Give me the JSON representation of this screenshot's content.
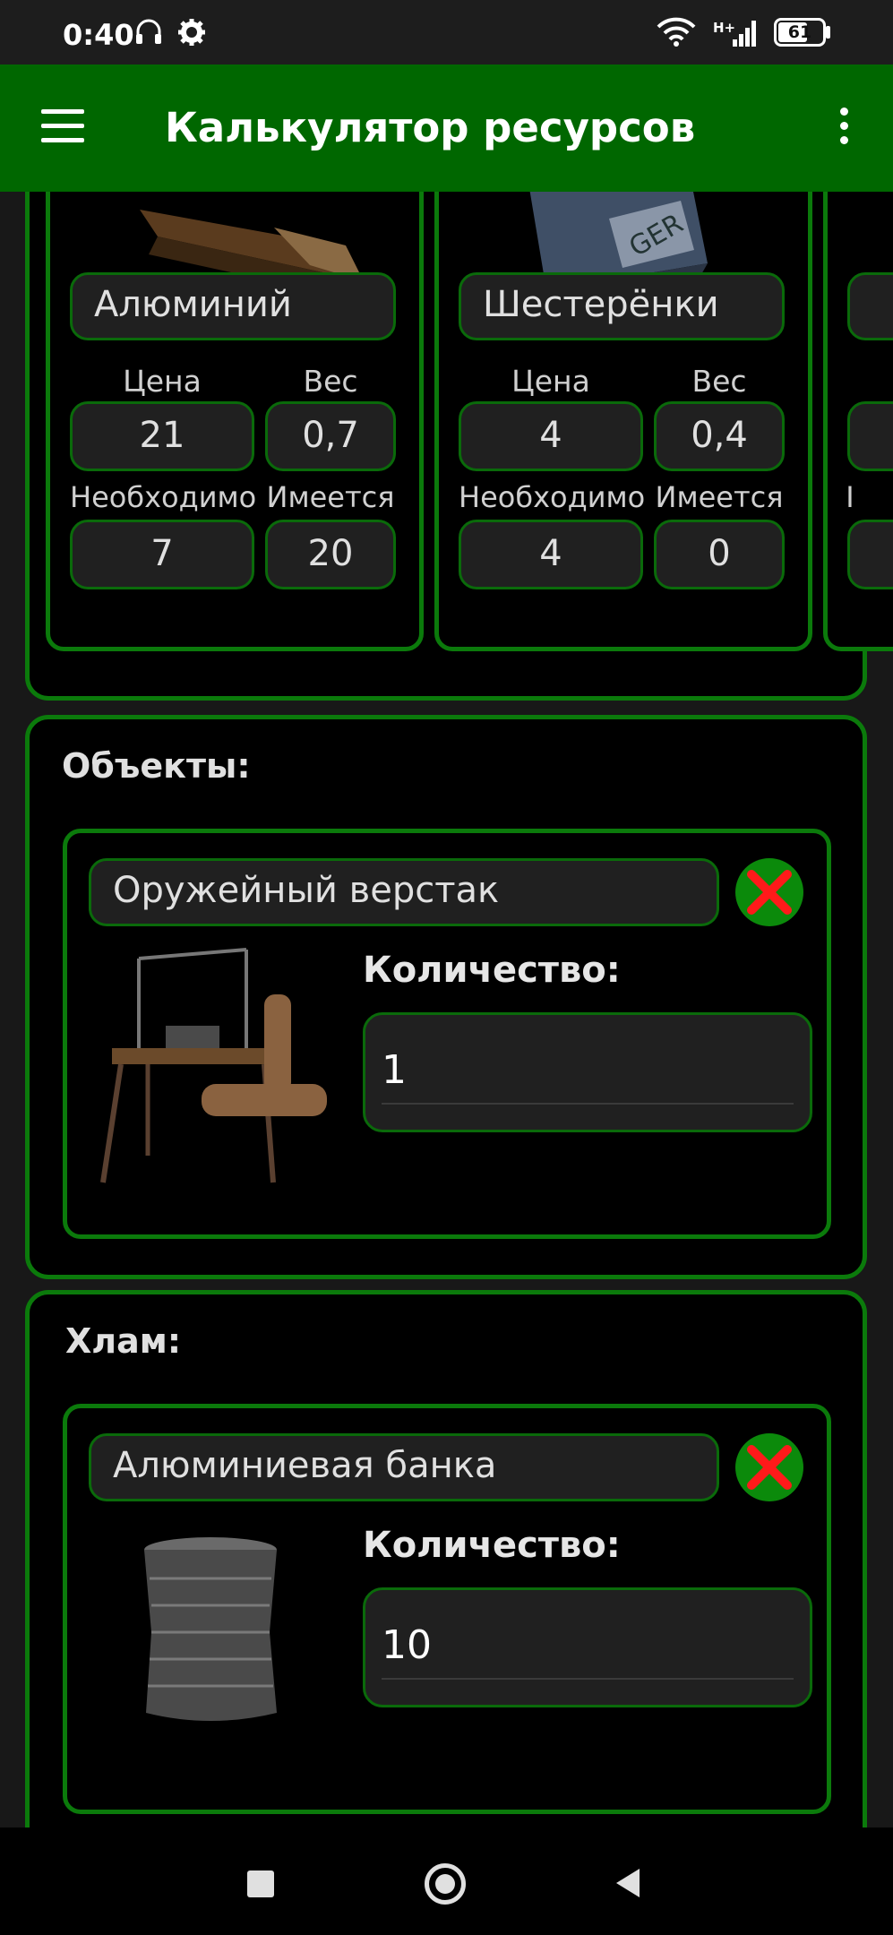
{
  "status": {
    "time": "0:40",
    "network": "H+",
    "battery": "61"
  },
  "app": {
    "title": "Калькулятор ресурсов"
  },
  "resources": {
    "items": [
      {
        "name": "Алюминий",
        "price_label": "Цена",
        "weight_label": "Вес",
        "price": "21",
        "weight": "0,7",
        "needed_label": "Необходимо",
        "have_label": "Имеется",
        "needed": "7",
        "have": "20"
      },
      {
        "name": "Шестерёнки",
        "price_label": "Цена",
        "weight_label": "Вес",
        "price": "4",
        "weight": "0,4",
        "needed_label": "Необходимо",
        "have_label": "Имеется",
        "needed": "4",
        "have": "0"
      }
    ],
    "partial_label": "I"
  },
  "objects": {
    "title": "Объекты:",
    "item": {
      "name": "Оружейный верстак",
      "qty_label": "Количество:",
      "qty": "1"
    }
  },
  "junk": {
    "title": "Хлам:",
    "item": {
      "name": "Алюминиевая банка",
      "qty_label": "Количество:",
      "qty": "10"
    }
  },
  "colors": {
    "accent": "#006700",
    "border": "#0b7a0b",
    "delete_x": "#ff1a1a"
  }
}
